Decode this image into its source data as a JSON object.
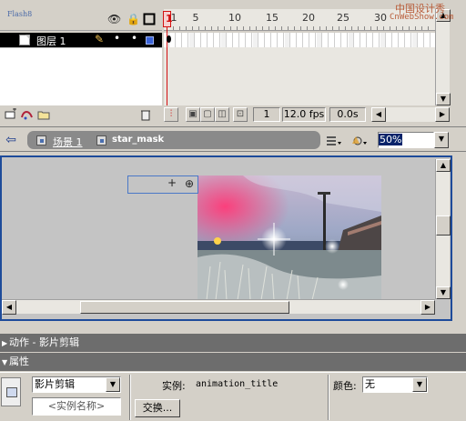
{
  "watermark": {
    "line1": "中国设计秀",
    "line2": "CnWebShow.com"
  },
  "timeline": {
    "app_tag": "Flash8",
    "layer_name": "图层 1",
    "ruler_numbers": [
      "1",
      "5",
      "10",
      "15",
      "20",
      "25",
      "30"
    ],
    "current_frame": "1",
    "frame_rate": "12.0 fps",
    "elapsed_time": "0.0s"
  },
  "edit_bar": {
    "scene": "场景 1",
    "symbol": "star_mask",
    "zoom": "50%"
  },
  "panels": {
    "actions_title": "动作 - 影片剪辑",
    "properties_title": "属性"
  },
  "properties": {
    "symbol_type": "影片剪辑",
    "instance_name_placeholder": "<实例名称>",
    "instance_label": "实例:",
    "instance_value": "animation_title",
    "swap_button": "交换...",
    "color_label": "颜色:",
    "color_value": "无"
  },
  "icons": {
    "eye": "eye-icon",
    "lock": "lock-icon",
    "outline": "outline-icon",
    "pencil": "pencil-icon",
    "back": "back-arrow-icon",
    "trash": "trash-icon"
  },
  "colors": {
    "playhead": "#d21010",
    "stage_border": "#1e4b9a",
    "panel_bar": "#6d6d6d",
    "selection": "#000000"
  }
}
